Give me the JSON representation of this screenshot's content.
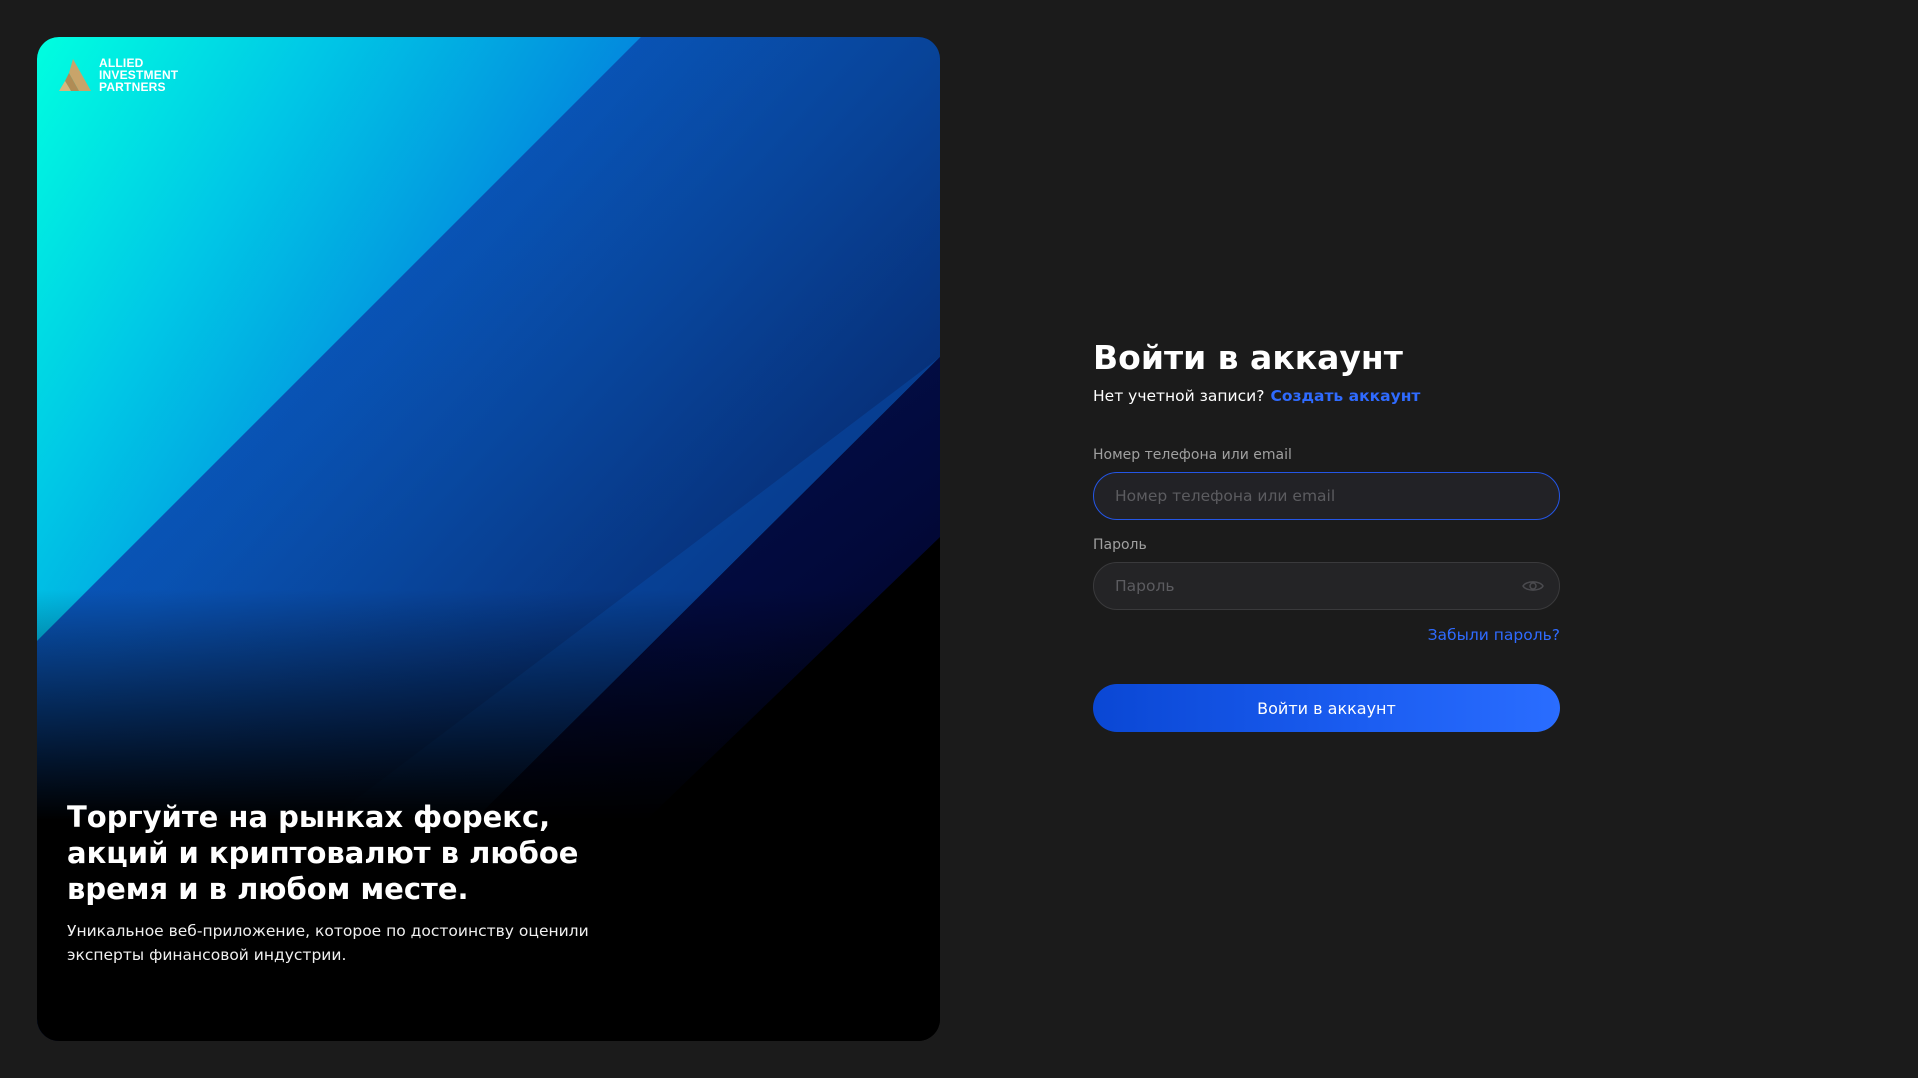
{
  "brand": {
    "logo_lines": [
      "ALLIED",
      "INVESTMENT",
      "PARTNERS"
    ],
    "logo_color": "#c8a46a"
  },
  "promo": {
    "title": "Торгуйте на рынках форекс,\nакций и криптовалют в любое\nвремя и в любом месте.",
    "subtitle": "Уникальное веб-приложение, которое по достоинству оценили\nэксперты финансовой индустрии."
  },
  "login": {
    "title": "Войти в аккаунт",
    "no_account_text": "Нет учетной записи?",
    "create_account_link": "Создать аккаунт",
    "login_label": "Номер телефона или email",
    "login_placeholder": "Номер телефона или email",
    "login_value": "",
    "password_label": "Пароль",
    "password_placeholder": "Пароль",
    "password_value": "",
    "forgot_link": "Забыли пароль?",
    "submit_label": "Войти в аккаунт"
  },
  "colors": {
    "background": "#1b1b1b",
    "accent": "#2f6bff",
    "button": "#1a5cf0",
    "input_bg": "#242426"
  },
  "icons": {
    "password_toggle": "eye-icon",
    "logo": "triangle-logo-icon"
  }
}
